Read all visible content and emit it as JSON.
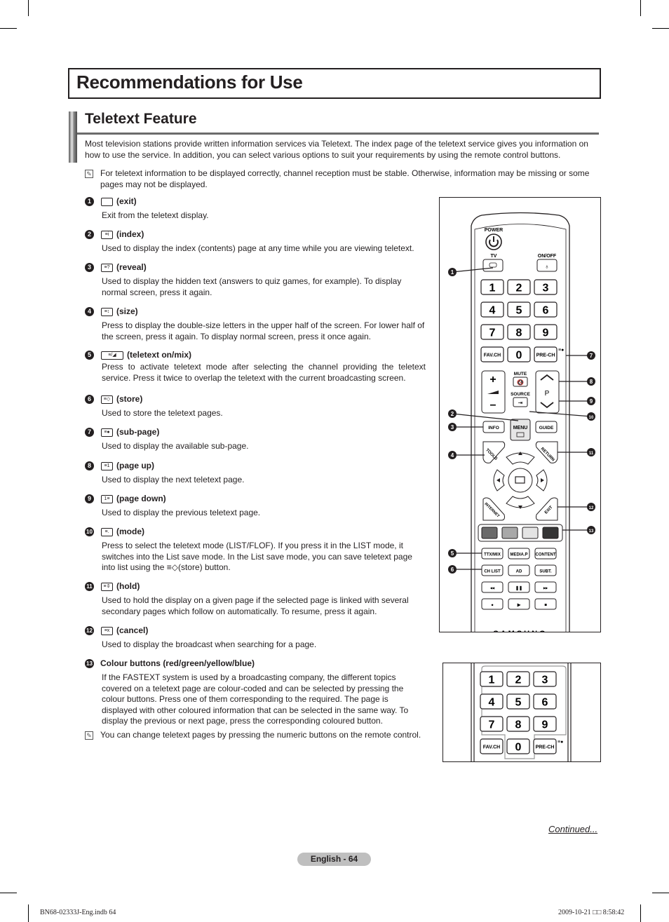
{
  "page": {
    "title": "Recommendations for Use",
    "section_title": "Teletext Feature",
    "intro": "Most television stations provide written information services via Teletext. The index page of the teletext service gives you information on how to use the service. In addition, you can select various options to suit your requirements by using the remote control buttons.",
    "note_top": "For teletext information to be displayed correctly, channel reception must be stable. Otherwise, information may be missing or some pages may not be displayed.",
    "note_bottom": "You can change teletext pages by pressing the numeric buttons on the remote control.",
    "note_icon": "note-icon"
  },
  "items": [
    {
      "num": "1",
      "icon": "exit-icon",
      "icon_glyph": "",
      "label": "(exit)",
      "desc": "Exit from the teletext display."
    },
    {
      "num": "2",
      "icon": "index-icon",
      "icon_glyph": "≡i",
      "label": "(index)",
      "desc": "Used to display the index (contents) page at any time while you are viewing teletext."
    },
    {
      "num": "3",
      "icon": "reveal-icon",
      "icon_glyph": "≡?",
      "label": "(reveal)",
      "desc": "Used to display the hidden text (answers to quiz games, for example). To display normal screen, press it again."
    },
    {
      "num": "4",
      "icon": "size-icon",
      "icon_glyph": "≡↕",
      "label": "(size)",
      "desc": "Press to display the double-size letters in the upper half of the screen. For lower half of the screen, press it again. To display normal screen, press it once again."
    },
    {
      "num": "5",
      "icon": "teletext-mix-icon",
      "icon_glyph": "≡/◢",
      "label": "(teletext on/mix)",
      "desc": "Press to activate teletext mode after selecting the channel providing the teletext service. Press it twice to overlap the teletext with the current broadcasting screen."
    },
    {
      "num": "6",
      "icon": "store-icon",
      "icon_glyph": "≡◇",
      "label": "(store)",
      "desc": "Used to store the teletext pages."
    },
    {
      "num": "7",
      "icon": "sub-page-icon",
      "icon_glyph": "≡●",
      "label": "(sub-page)",
      "desc": "Used to display the available sub-page."
    },
    {
      "num": "8",
      "icon": "page-up-icon",
      "icon_glyph": "≡1",
      "label": "(page up)",
      "desc": "Used to display the next teletext page."
    },
    {
      "num": "9",
      "icon": "page-down-icon",
      "icon_glyph": "1≡",
      "label": "(page down)",
      "desc": "Used to display the previous teletext page."
    },
    {
      "num": "10",
      "icon": "mode-icon",
      "icon_glyph": "≡.",
      "label": "(mode)",
      "desc": "Press to select the teletext mode (LIST/FLOF). If you press it in the LIST mode, it switches into the List save mode. In the List save mode, you can save teletext page into list using the ≡◇(store) button."
    },
    {
      "num": "11",
      "icon": "hold-icon",
      "icon_glyph": "≡⇕",
      "label": "(hold)",
      "desc": "Used to hold the display on a given page if the selected page is linked with several secondary pages which follow on automatically. To resume, press it again."
    },
    {
      "num": "12",
      "icon": "cancel-icon",
      "icon_glyph": "≡x",
      "label": "(cancel)",
      "desc": "Used to display the broadcast when searching for a page."
    },
    {
      "num": "13",
      "icon": "",
      "icon_glyph": "",
      "label": "Colour buttons (red/green/yellow/blue)",
      "desc": "If the FASTEXT system is used by a broadcasting company, the different topics covered on a teletext page are colour-coded and can be selected by pressing the colour buttons. Press one of them corresponding to the required. The page is displayed with other coloured information that can be selected in the same way. To display the previous or next page, press the corresponding coloured button."
    }
  ],
  "remote": {
    "labels": {
      "power": "POWER",
      "tv": "TV",
      "onoff": "ON/OFF",
      "favch": "FAV.CH",
      "prech": "PRE-CH",
      "mute": "MUTE",
      "source": "SOURCE",
      "p": "P",
      "info": "INFO",
      "menu": "MENU",
      "guide": "GUIDE",
      "tools": "TOOLS",
      "return": "RETURN",
      "internet": "INTERNET",
      "exit": "EXIT",
      "ttxmix": "TTX/MIX",
      "mediap": "MEDIA.P",
      "content": "CONTENT",
      "chlist": "CH LIST",
      "ad": "AD",
      "subt": "SUBT.",
      "brand": "SAMSUNG"
    },
    "digits": [
      "1",
      "2",
      "3",
      "4",
      "5",
      "6",
      "7",
      "8",
      "9",
      "0"
    ],
    "colour_buttons": [
      "#6a6a6a",
      "#a8a8a8",
      "#e4e4e4",
      "#353535"
    ],
    "callouts": [
      "1",
      "2",
      "3",
      "4",
      "5",
      "6",
      "7",
      "8",
      "9",
      "10",
      "11",
      "12",
      "13"
    ]
  },
  "footer": {
    "continued": "Continued...",
    "page_label": "English - 64",
    "imprint_left": "BN68-02333J-Eng.indb   64",
    "imprint_right": "2009-10-21   □□ 8:58:42"
  }
}
